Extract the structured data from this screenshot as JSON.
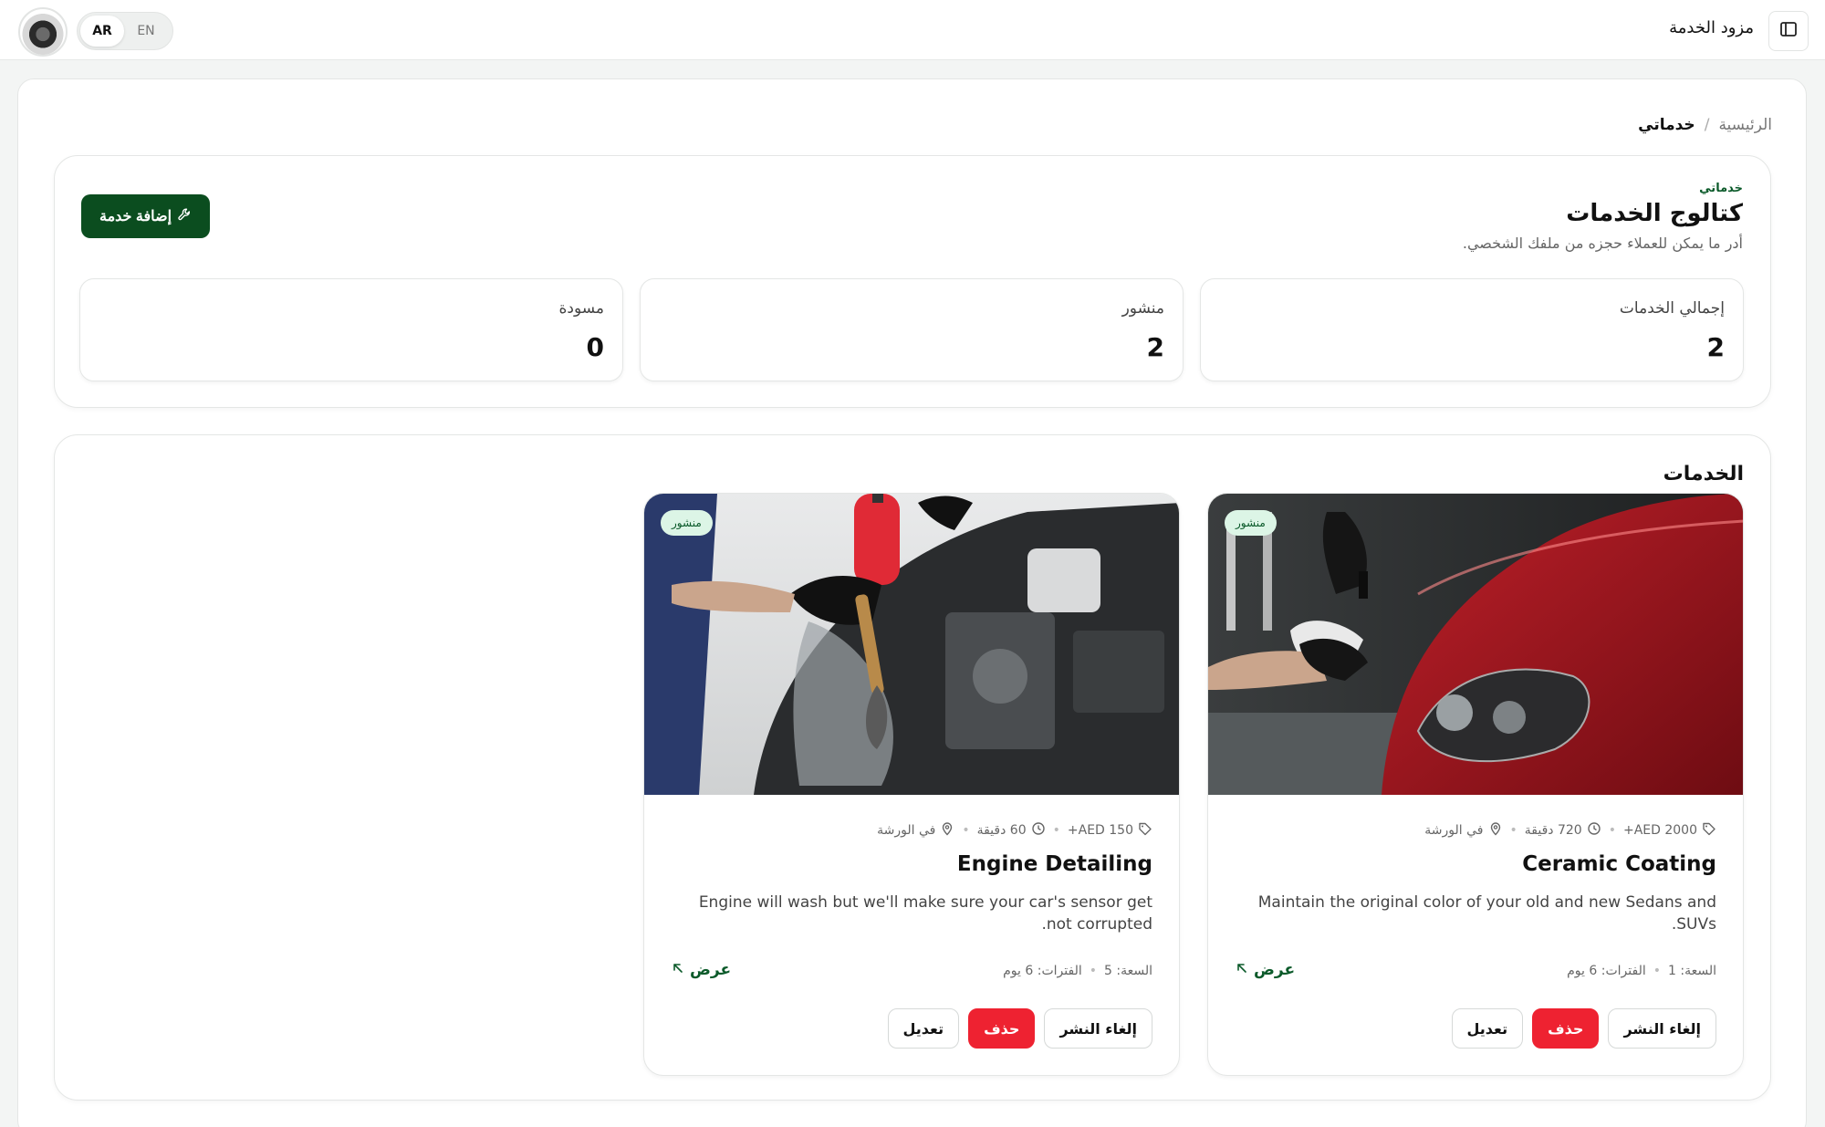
{
  "topbar": {
    "lang": {
      "ar": "AR",
      "en": "EN",
      "active": "AR"
    },
    "provider_label": "مزود الخدمة"
  },
  "breadcrumb": {
    "home": "الرئيسية",
    "separator": "/",
    "current": "خدماتي"
  },
  "header": {
    "eyebrow": "خدماتي",
    "title": "كتالوج الخدمات",
    "subtitle": "أدر ما يمكن للعملاء حجزه من ملفك الشخصي.",
    "add_button": "إضافة خدمة"
  },
  "stats": [
    {
      "label": "إجمالي الخدمات",
      "value": "2"
    },
    {
      "label": "منشور",
      "value": "2"
    },
    {
      "label": "مسودة",
      "value": "0"
    }
  ],
  "services": {
    "title": "الخدمات",
    "items": [
      {
        "badge": "منشور",
        "price": "AED 2000+",
        "duration": "720 دقيقة",
        "location": "في الورشة",
        "name": "Ceramic Coating",
        "description": "Maintain the original color of your old and new Sedans and SUVs.",
        "capacity": "السعة: 1",
        "slots": "الفترات: 6 يوم",
        "view": "عرض",
        "unpublish": "إلغاء النشر",
        "delete": "حذف",
        "edit": "تعديل"
      },
      {
        "badge": "منشور",
        "price": "AED 150+",
        "duration": "60 دقيقة",
        "location": "في الورشة",
        "name": "Engine Detailing",
        "description": "Engine will wash but we'll make sure your car's sensor get not corrupted.",
        "capacity": "السعة: 5",
        "slots": "الفترات: 6 يوم",
        "view": "عرض",
        "unpublish": "إلغاء النشر",
        "delete": "حذف",
        "edit": "تعديل"
      }
    ]
  },
  "colors": {
    "primary": "#0b4d1f",
    "danger": "#ee2231",
    "badge_bg": "#dcf5e6",
    "badge_text": "#0b5a2a"
  },
  "icons": [
    "sidebar-toggle-icon",
    "wrench-icon",
    "tag-icon",
    "clock-icon",
    "map-pin-icon",
    "arrow-up-left-icon"
  ]
}
